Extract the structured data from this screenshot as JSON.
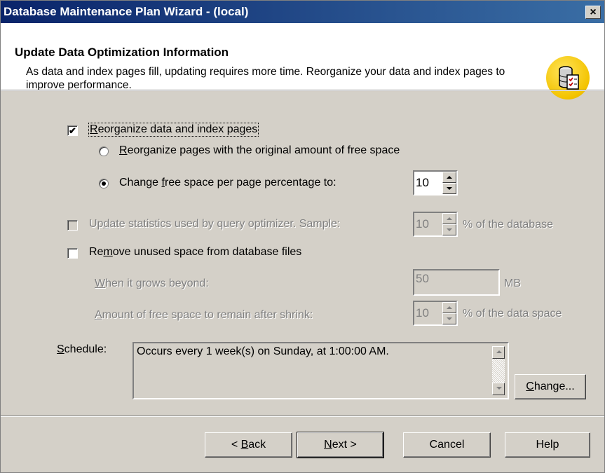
{
  "window": {
    "title": "Database Maintenance Plan Wizard - (local)",
    "close_label": "×"
  },
  "header": {
    "title": "Update Data Optimization Information",
    "description": "As data and index pages fill, updating requires more time. Reorganize your data and index pages to improve performance.",
    "icon": "database-checklist-icon"
  },
  "reorganize": {
    "checked": true,
    "label_prefix": "",
    "label_mnemonic": "R",
    "label_rest": "eorganize data and index pages",
    "option_original": {
      "selected": false,
      "label_prefix": "",
      "label_mnemonic": "R",
      "label_rest": "eorganize pages with the original amount of free space"
    },
    "option_change": {
      "selected": true,
      "label_prefix": "Change ",
      "label_mnemonic": "f",
      "label_rest": "ree space per page percentage to:",
      "value": "10"
    }
  },
  "update_statistics": {
    "checked": false,
    "enabled": false,
    "label_prefix": "Up",
    "label_mnemonic": "d",
    "label_rest": "ate statistics used by query optimizer. Sample:",
    "value": "10",
    "suffix": "% of the database"
  },
  "remove_unused": {
    "checked": false,
    "label_prefix": "Re",
    "label_mnemonic": "m",
    "label_rest": "ove unused space from database files",
    "grows_beyond": {
      "label_prefix": "",
      "label_mnemonic": "W",
      "label_rest": "hen it grows beyond:",
      "value": "50",
      "unit": "MB"
    },
    "free_space_after": {
      "label_prefix": "",
      "label_mnemonic": "A",
      "label_rest": "mount of free space to remain after shrink:",
      "value": "10",
      "suffix": "% of the data space"
    }
  },
  "schedule": {
    "label_mnemonic": "S",
    "label_rest": "chedule:",
    "text": "Occurs every 1 week(s) on Sunday, at 1:00:00 AM.",
    "change_mnemonic": "C",
    "change_rest": "hange..."
  },
  "buttons": {
    "back_prefix": "< ",
    "back_mnemonic": "B",
    "back_rest": "ack",
    "next_mnemonic": "N",
    "next_rest": "ext >",
    "cancel": "Cancel",
    "help": "Help"
  },
  "colors": {
    "face": "#d4d0c8",
    "title_bar_start": "#0a246a",
    "title_bar_end": "#3a6ea5",
    "header_bg": "#ffffff",
    "disabled_text": "#808080"
  }
}
